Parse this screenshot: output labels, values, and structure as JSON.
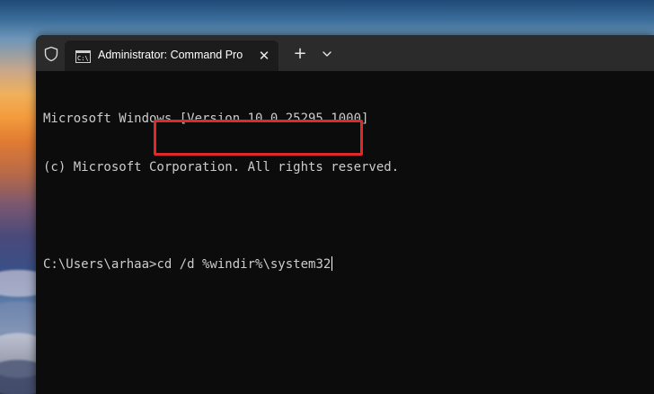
{
  "window": {
    "tab_title": "Administrator: Command Pro",
    "close_tab_glyph": "✕",
    "new_tab_glyph": "+",
    "dropdown_icon": "chevron-down-icon",
    "admin_icon": "shield-icon",
    "tab_icon": "cmd-icon"
  },
  "console": {
    "lines": [
      "Microsoft Windows [Version 10.0.25295.1000]",
      "(c) Microsoft Corporation. All rights reserved.",
      ""
    ],
    "prompt": "C:\\Users\\arhaa>",
    "command": "cd /d %windir%\\system32"
  },
  "colors": {
    "terminal_bg": "#0c0c0c",
    "tabbar_bg": "#2b2b2b",
    "active_tab_bg": "#1c1c1c",
    "text": "#cccccc",
    "highlight": "#e02a2a"
  }
}
